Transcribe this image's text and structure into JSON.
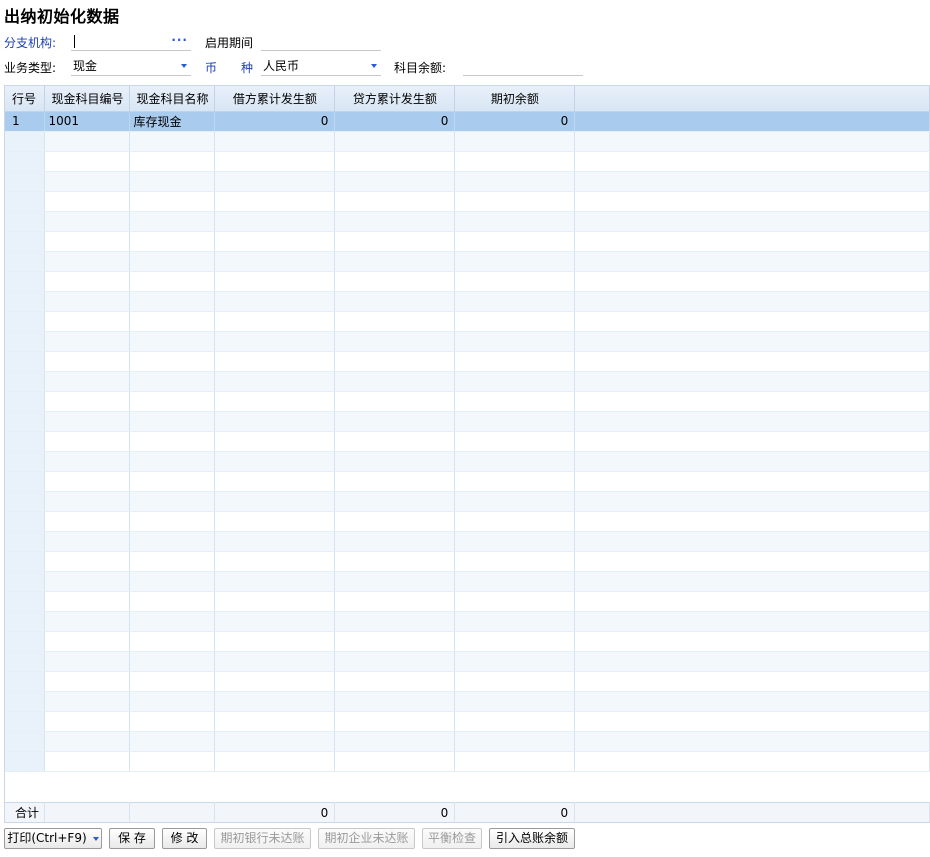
{
  "title": "出纳初始化数据",
  "form": {
    "branch_label": "分支机构:",
    "branch_value": "",
    "period_label": "启用期间",
    "period_value": "",
    "biz_type_label": "业务类型:",
    "biz_type_value": "现金",
    "currency_label_1": "币",
    "currency_label_2": "种",
    "currency_value": "人民币",
    "subject_balance_label": "科目余额:",
    "subject_balance_value": ""
  },
  "table": {
    "headers": [
      "行号",
      "现金科目编号",
      "现金科目名称",
      "借方累计发生额",
      "贷方累计发生额",
      "期初余额"
    ],
    "rows": [
      {
        "row": "1",
        "code": "1001",
        "name": "库存现金",
        "debit": "0",
        "credit": "0",
        "opening": "0"
      }
    ],
    "footer": {
      "label": "合计",
      "debit": "0",
      "credit": "0",
      "opening": "0"
    }
  },
  "buttons": {
    "print": "打印(Ctrl+F9)",
    "save": "保 存",
    "modify": "修 改",
    "bank_unreconciled": "期初银行未达账",
    "enterprise_unreconciled": "期初企业未达账",
    "balance_check": "平衡检查",
    "import_gl": "引入总账余额"
  },
  "colors": {
    "selected_row": "#a9cbee",
    "header_bg": "#dde8f6",
    "label_blue": "#1c3fb5",
    "dropdown_arrow": "#2a5bd7"
  }
}
